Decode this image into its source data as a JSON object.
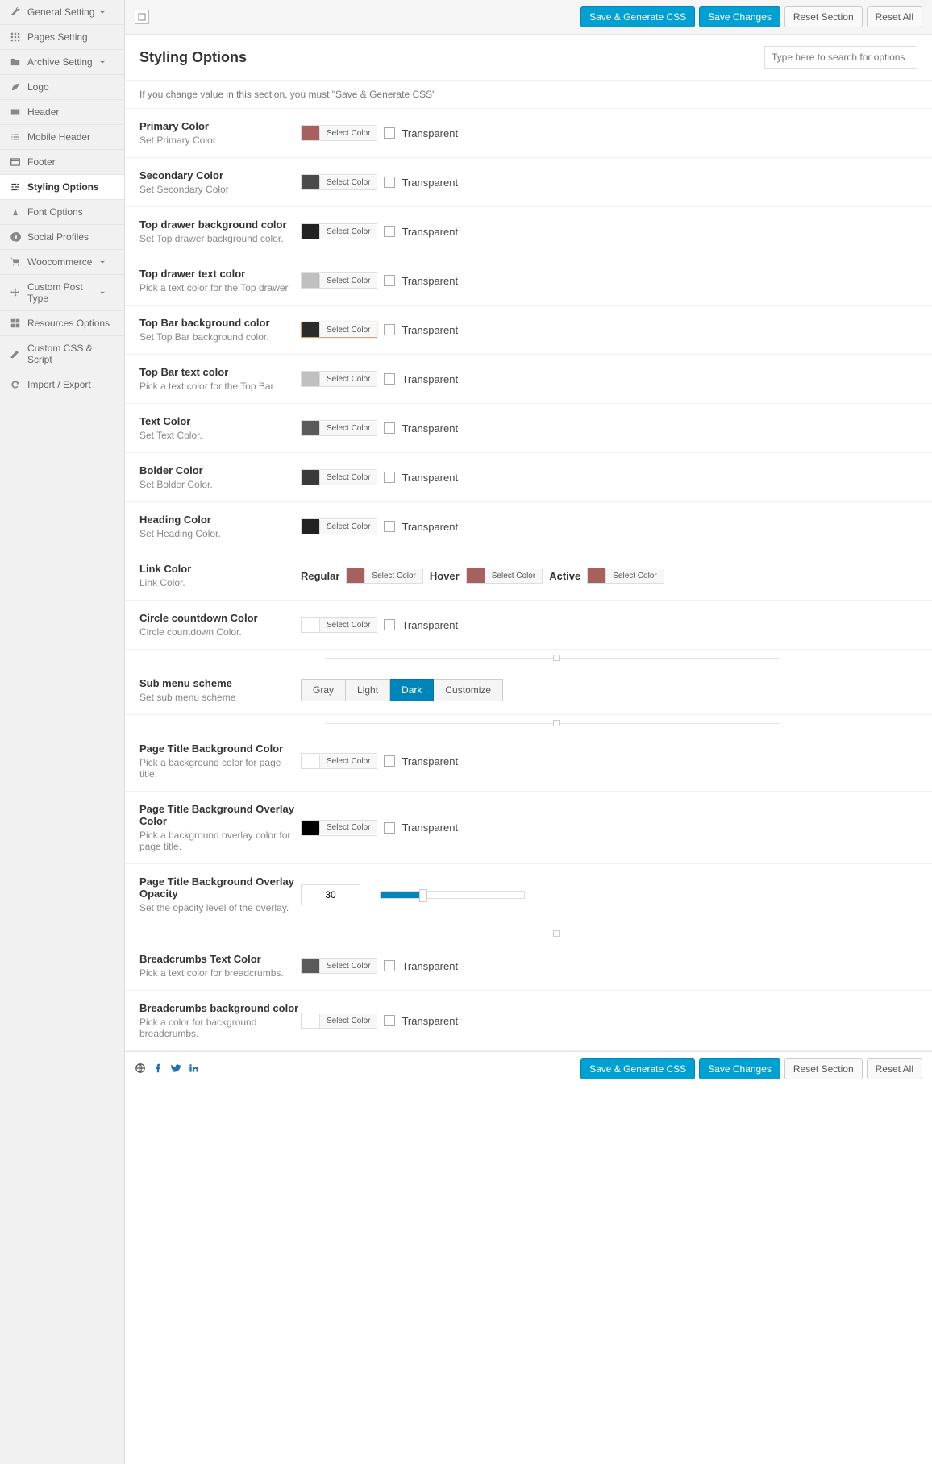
{
  "sidebar": {
    "items": [
      {
        "label": "General Setting",
        "icon": "wrench",
        "chev": true
      },
      {
        "label": "Pages Setting",
        "icon": "grid"
      },
      {
        "label": "Archive Setting",
        "icon": "folder",
        "chev": true
      },
      {
        "label": "Logo",
        "icon": "leaf"
      },
      {
        "label": "Header",
        "icon": "card"
      },
      {
        "label": "Mobile Header",
        "icon": "list"
      },
      {
        "label": "Footer",
        "icon": "window"
      },
      {
        "label": "Styling Options",
        "icon": "sliders",
        "active": true
      },
      {
        "label": "Font Options",
        "icon": "font"
      },
      {
        "label": "Social Profiles",
        "icon": "pinterest"
      },
      {
        "label": "Woocommerce",
        "icon": "cart",
        "chev": true
      },
      {
        "label": "Custom Post Type",
        "icon": "move",
        "chev": true
      },
      {
        "label": "Resources Options",
        "icon": "blocks"
      },
      {
        "label": "Custom CSS & Script",
        "icon": "edit"
      },
      {
        "label": "Import / Export",
        "icon": "refresh"
      }
    ]
  },
  "buttons": {
    "saveGen": "Save & Generate CSS",
    "saveChanges": "Save Changes",
    "resetSection": "Reset Section",
    "resetAll": "Reset All"
  },
  "title": "Styling Options",
  "searchPlaceholder": "Type here to search for options",
  "notice": "If you change value in this section, you must \"Save & Generate CSS\"",
  "labels": {
    "selectColor": "Select Color",
    "transparent": "Transparent",
    "regular": "Regular",
    "hover": "Hover",
    "active": "Active"
  },
  "scheme": {
    "options": [
      "Gray",
      "Light",
      "Dark",
      "Customize"
    ],
    "selected": "Dark"
  },
  "opacityValue": "30",
  "rows": {
    "primary": {
      "t": "Primary Color",
      "d": "Set Primary Color",
      "c": "#a6605e"
    },
    "secondary": {
      "t": "Secondary Color",
      "d": "Set Secondary Color",
      "c": "#4a4a4a"
    },
    "topdrawerbg": {
      "t": "Top drawer background color",
      "d": "Set Top drawer background color.",
      "c": "#222222"
    },
    "topdrawertxt": {
      "t": "Top drawer text color",
      "d": "Pick a text color for the Top drawer",
      "c": "#c0c0c0"
    },
    "topbarbg": {
      "t": "Top Bar background color",
      "d": "Set Top Bar background color.",
      "c": "#2b2b2b",
      "hl": true
    },
    "topbartxt": {
      "t": "Top Bar text color",
      "d": "Pick a text color for the Top Bar",
      "c": "#c0c0c0"
    },
    "textcolor": {
      "t": "Text Color",
      "d": "Set Text Color.",
      "c": "#5a5a5a"
    },
    "bolder": {
      "t": "Bolder Color",
      "d": "Set Bolder Color.",
      "c": "#3a3a3a"
    },
    "heading": {
      "t": "Heading Color",
      "d": "Set Heading Color.",
      "c": "#222222"
    },
    "link": {
      "t": "Link Color",
      "d": "Link Color.",
      "reg": "#a6605e",
      "hov": "#a6605e",
      "act": "#a6605e"
    },
    "circle": {
      "t": "Circle countdown Color",
      "d": "Circle countdown Color.",
      "c": "#ffffff"
    },
    "submenu": {
      "t": "Sub menu scheme",
      "d": "Set sub menu scheme"
    },
    "ptbg": {
      "t": "Page Title Background Color",
      "d": "Pick a background color for page title.",
      "c": "#ffffff"
    },
    "ptoverlay": {
      "t": "Page Title Background Overlay Color",
      "d": "Pick a background overlay color for page title.",
      "c": "#000000"
    },
    "ptopacity": {
      "t": "Page Title Background Overlay Opacity",
      "d": "Set the opacity level of the overlay."
    },
    "bctxt": {
      "t": "Breadcrumbs Text Color",
      "d": "Pick a text color for breadcrumbs.",
      "c": "#5a5a5a"
    },
    "bcbg": {
      "t": "Breadcrumbs background color",
      "d": "Pick a color for background breadcrumbs.",
      "c": "#ffffff"
    }
  }
}
